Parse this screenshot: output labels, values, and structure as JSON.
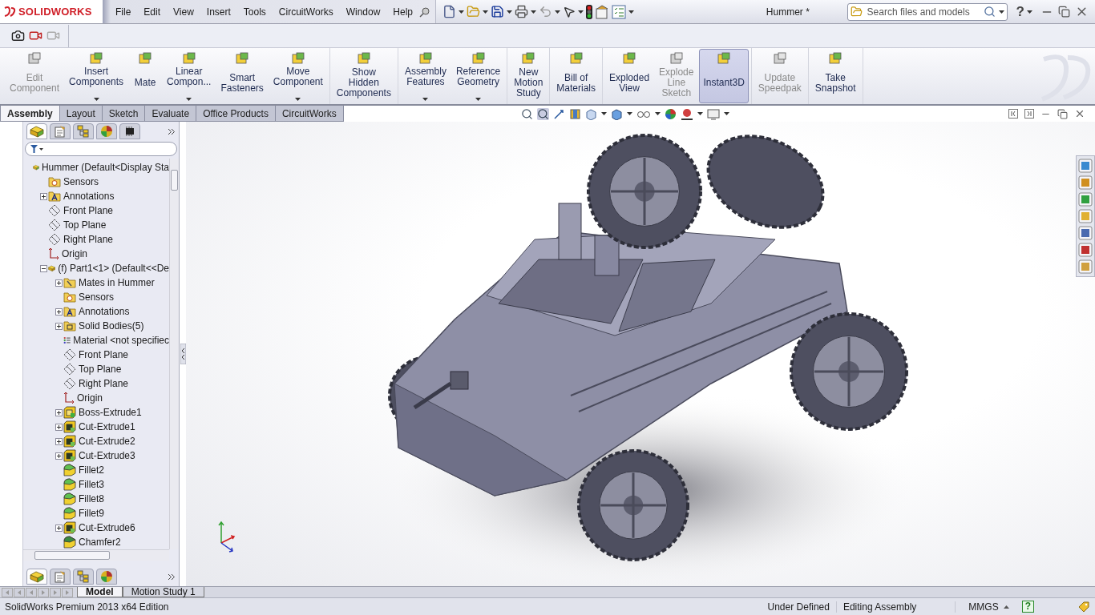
{
  "app": {
    "logo_text": "SOLIDWORKS",
    "document_title": "Hummer *"
  },
  "menu": [
    "File",
    "Edit",
    "View",
    "Insert",
    "Tools",
    "CircuitWorks",
    "Window",
    "Help"
  ],
  "search": {
    "placeholder": "Search files and models"
  },
  "help_glyph": "?",
  "ribbon": {
    "groups": [
      {
        "buttons": [
          {
            "label": "Edit\nComponent",
            "disabled": true,
            "selected": false,
            "dropdown": false
          },
          {
            "label": "Insert\nComponents",
            "disabled": false,
            "selected": false,
            "dropdown": true
          },
          {
            "label": "Mate",
            "disabled": false,
            "selected": false,
            "dropdown": false
          },
          {
            "label": "Linear\nCompon...",
            "disabled": false,
            "selected": false,
            "dropdown": true
          },
          {
            "label": "Smart\nFasteners",
            "disabled": false,
            "selected": false,
            "dropdown": false
          },
          {
            "label": "Move\nComponent",
            "disabled": false,
            "selected": false,
            "dropdown": true
          }
        ]
      },
      {
        "buttons": [
          {
            "label": "Show\nHidden\nComponents",
            "disabled": false,
            "selected": false,
            "dropdown": false
          }
        ]
      },
      {
        "buttons": [
          {
            "label": "Assembly\nFeatures",
            "disabled": false,
            "selected": false,
            "dropdown": true
          },
          {
            "label": "Reference\nGeometry",
            "disabled": false,
            "selected": false,
            "dropdown": true
          }
        ]
      },
      {
        "buttons": [
          {
            "label": "New\nMotion\nStudy",
            "disabled": false,
            "selected": false,
            "dropdown": false
          }
        ]
      },
      {
        "buttons": [
          {
            "label": "Bill of\nMaterials",
            "disabled": false,
            "selected": false,
            "dropdown": false
          }
        ]
      },
      {
        "buttons": [
          {
            "label": "Exploded\nView",
            "disabled": false,
            "selected": false,
            "dropdown": false
          },
          {
            "label": "Explode\nLine\nSketch",
            "disabled": true,
            "selected": false,
            "dropdown": false
          },
          {
            "label": "Instant3D",
            "disabled": false,
            "selected": true,
            "dropdown": false
          }
        ]
      },
      {
        "buttons": [
          {
            "label": "Update\nSpeedpak",
            "disabled": true,
            "selected": false,
            "dropdown": false
          }
        ]
      },
      {
        "buttons": [
          {
            "label": "Take\nSnapshot",
            "disabled": false,
            "selected": false,
            "dropdown": false
          }
        ]
      }
    ]
  },
  "command_tabs": [
    {
      "label": "Assembly",
      "selected": true
    },
    {
      "label": "Layout",
      "selected": false
    },
    {
      "label": "Sketch",
      "selected": false
    },
    {
      "label": "Evaluate",
      "selected": false
    },
    {
      "label": "Office Products",
      "selected": false
    },
    {
      "label": "CircuitWorks",
      "selected": false
    }
  ],
  "feature_manager": {
    "panel_tabs": [
      {
        "kind": "tree",
        "selected": true
      },
      {
        "kind": "properties",
        "selected": false
      },
      {
        "kind": "config",
        "selected": false
      },
      {
        "kind": "appearance",
        "selected": false
      },
      {
        "kind": "chip",
        "selected": false
      }
    ],
    "tree": [
      {
        "label": "Hummer  (Default<Display Sta",
        "kind": "assembly",
        "children": [
          {
            "label": "Sensors",
            "kind": "sensor"
          },
          {
            "label": "Annotations",
            "kind": "annotation",
            "expanded": false
          },
          {
            "label": "Front Plane",
            "kind": "plane"
          },
          {
            "label": "Top Plane",
            "kind": "plane"
          },
          {
            "label": "Right Plane",
            "kind": "plane"
          },
          {
            "label": "Origin",
            "kind": "origin"
          },
          {
            "label": "(f) Part1<1> (Default<<De",
            "kind": "part",
            "expanded": true,
            "children": [
              {
                "label": "Mates in Hummer",
                "kind": "mates",
                "expanded": false
              },
              {
                "label": "Sensors",
                "kind": "sensor"
              },
              {
                "label": "Annotations",
                "kind": "annotation",
                "expanded": false
              },
              {
                "label": "Solid Bodies(5)",
                "kind": "bodies",
                "expanded": false
              },
              {
                "label": "Material <not specifiec",
                "kind": "material"
              },
              {
                "label": "Front Plane",
                "kind": "plane"
              },
              {
                "label": "Top Plane",
                "kind": "plane"
              },
              {
                "label": "Right Plane",
                "kind": "plane"
              },
              {
                "label": "Origin",
                "kind": "origin"
              },
              {
                "label": "Boss-Extrude1",
                "kind": "boss",
                "expanded": false
              },
              {
                "label": "Cut-Extrude1",
                "kind": "cut",
                "expanded": false
              },
              {
                "label": "Cut-Extrude2",
                "kind": "cut",
                "expanded": false
              },
              {
                "label": "Cut-Extrude3",
                "kind": "cut",
                "expanded": false
              },
              {
                "label": "Fillet2",
                "kind": "fillet"
              },
              {
                "label": "Fillet3",
                "kind": "fillet"
              },
              {
                "label": "Fillet8",
                "kind": "fillet"
              },
              {
                "label": "Fillet9",
                "kind": "fillet"
              },
              {
                "label": "Cut-Extrude6",
                "kind": "cut",
                "expanded": false
              },
              {
                "label": "Chamfer2",
                "kind": "chamfer"
              }
            ]
          }
        ]
      }
    ],
    "bottom_tabs": [
      {
        "kind": "tree",
        "selected": true
      },
      {
        "kind": "properties",
        "selected": false
      },
      {
        "kind": "config",
        "selected": false
      },
      {
        "kind": "appearance",
        "selected": false
      }
    ]
  },
  "model_tabs": [
    {
      "label": "Model",
      "selected": true
    },
    {
      "label": "Motion Study 1",
      "selected": false
    }
  ],
  "status_bar": {
    "edition": "SolidWorks Premium 2013 x64 Edition",
    "state": "Under Defined",
    "mode": "Editing Assembly",
    "units": "MMGS",
    "help_glyph": "?"
  }
}
